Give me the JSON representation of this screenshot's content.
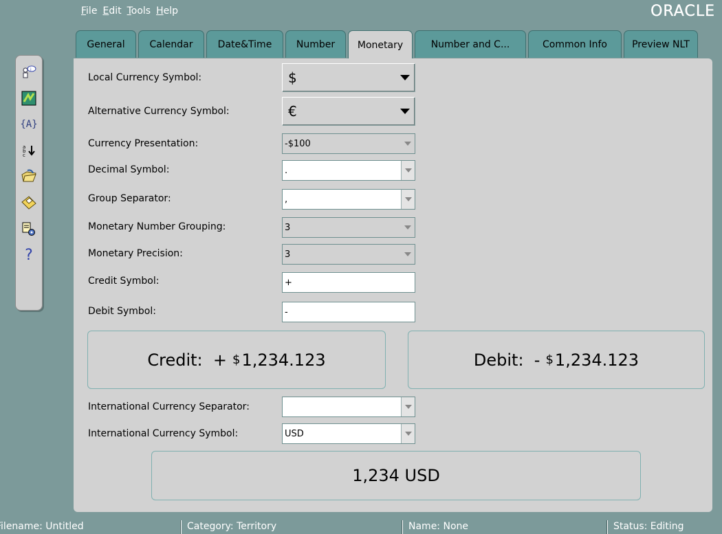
{
  "menu": [
    {
      "mnemonic": "F",
      "rest": "ile"
    },
    {
      "mnemonic": "E",
      "rest": "dit"
    },
    {
      "mnemonic": "T",
      "rest": "ools"
    },
    {
      "mnemonic": "H",
      "rest": "elp"
    }
  ],
  "brand": "ORACLE",
  "tabs": [
    "General",
    "Calendar",
    "Date&Time",
    "Number",
    "Monetary",
    "Number and C...",
    "Common Info",
    "Preview NLT"
  ],
  "active_tab": "Monetary",
  "toolbar_icons": [
    "user-info-icon",
    "map-icon",
    "variables-icon",
    "sort-icon",
    "open-folder-icon",
    "save-disk-icon",
    "settings-icon",
    "help-icon"
  ],
  "form": {
    "local_currency_symbol": {
      "label": "Local Currency Symbol:",
      "value": "$"
    },
    "alternative_currency_symbol": {
      "label": "Alternative Currency Symbol:",
      "value": "€"
    },
    "currency_presentation": {
      "label": "Currency Presentation:",
      "value": "-$100"
    },
    "decimal_symbol": {
      "label": "Decimal Symbol:",
      "value": "."
    },
    "group_separator": {
      "label": "Group Separator:",
      "value": ","
    },
    "monetary_number_grouping": {
      "label": "Monetary Number Grouping:",
      "value": "3"
    },
    "monetary_precision": {
      "label": "Monetary Precision:",
      "value": "3"
    },
    "credit_symbol": {
      "label": "Credit Symbol:",
      "value": "+"
    },
    "debit_symbol": {
      "label": "Debit Symbol:",
      "value": "-"
    },
    "international_currency_separator": {
      "label": "International Currency Separator:",
      "value": ""
    },
    "international_currency_symbol": {
      "label": "International Currency Symbol:",
      "value": "USD"
    }
  },
  "preview": {
    "credit": {
      "prefix": "Credit:  +",
      "currency": "$",
      "amount": "1,234.123"
    },
    "debit": {
      "prefix": "Debit:  -",
      "currency": "$",
      "amount": "1,234.123"
    },
    "international": "1,234 USD"
  },
  "status": {
    "filename": "Filename: Untitled",
    "category": "Category: Territory",
    "name": "Name: None",
    "status": "Status: Editing"
  }
}
